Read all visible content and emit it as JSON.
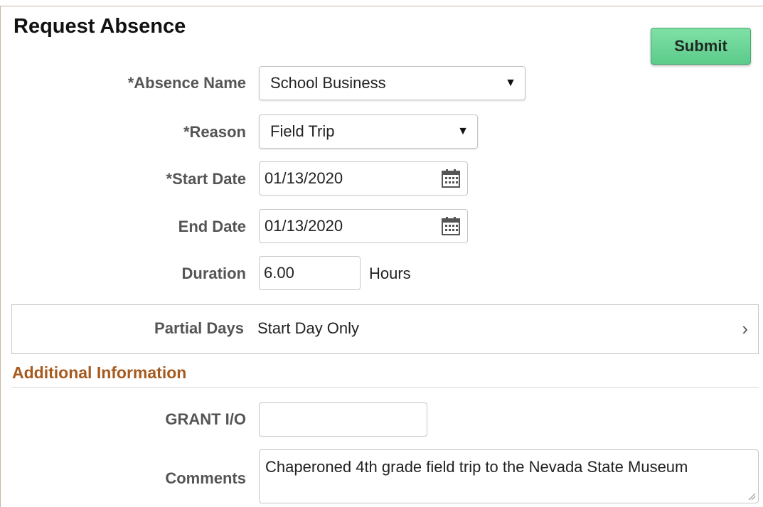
{
  "header": {
    "title": "Request Absence",
    "submit_label": "Submit"
  },
  "form": {
    "absence_name": {
      "label": "*Absence Name",
      "value": "School Business"
    },
    "reason": {
      "label": "*Reason",
      "value": "Field Trip"
    },
    "start_date": {
      "label": "*Start Date",
      "value": "01/13/2020"
    },
    "end_date": {
      "label": "End Date",
      "value": "01/13/2020"
    },
    "duration": {
      "label": "Duration",
      "value": "6.00",
      "unit": "Hours"
    },
    "partial_days": {
      "label": "Partial Days",
      "value": "Start Day Only"
    }
  },
  "additional": {
    "section_title": "Additional Information",
    "grant": {
      "label": "GRANT I/O",
      "value": ""
    },
    "comments": {
      "label": "Comments",
      "value": "Chaperoned 4th grade field trip to the Nevada State Museum"
    }
  },
  "colors": {
    "submit_bg": "#6fd79a",
    "section_title": "#a65a1e"
  }
}
